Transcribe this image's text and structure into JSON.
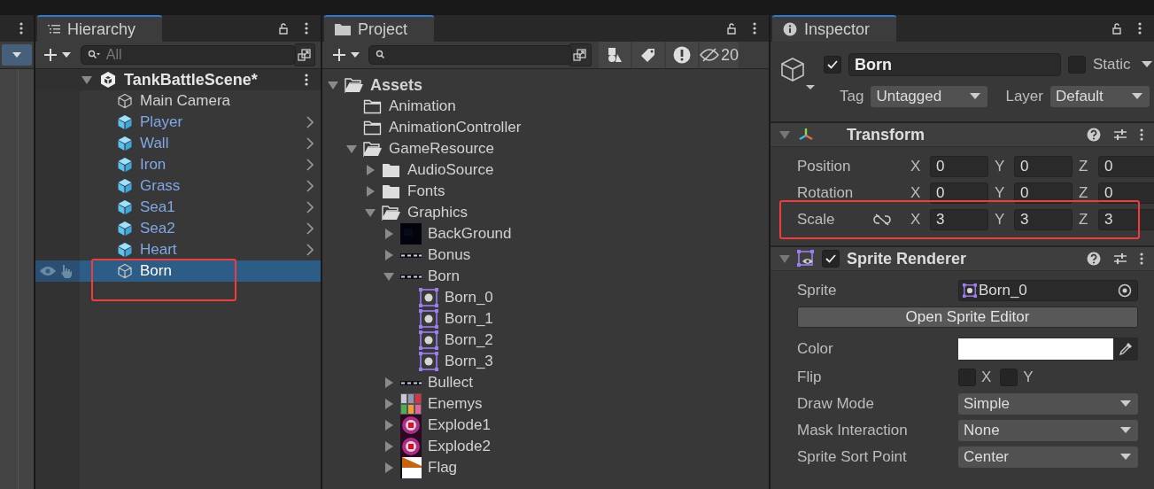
{
  "hierarchy": {
    "tab": "Hierarchy",
    "search": {
      "placeholder": "All"
    },
    "scene": {
      "name": "TankBattleScene*",
      "expanded": true
    },
    "items": [
      {
        "name": "Main Camera",
        "kind": "object",
        "selected": false,
        "annotated": false
      },
      {
        "name": "Player",
        "kind": "prefab",
        "selected": false,
        "annotated": false
      },
      {
        "name": "Wall",
        "kind": "prefab",
        "selected": false,
        "annotated": false
      },
      {
        "name": "Iron",
        "kind": "prefab",
        "selected": false,
        "annotated": false
      },
      {
        "name": "Grass",
        "kind": "prefab",
        "selected": false,
        "annotated": false
      },
      {
        "name": "Sea1",
        "kind": "prefab",
        "selected": false,
        "annotated": false
      },
      {
        "name": "Sea2",
        "kind": "prefab",
        "selected": false,
        "annotated": false
      },
      {
        "name": "Heart",
        "kind": "prefab",
        "selected": false,
        "annotated": false
      },
      {
        "name": "Born",
        "kind": "object",
        "selected": true,
        "annotated": true
      }
    ]
  },
  "project": {
    "tab": "Project",
    "hidden_count": "20",
    "tree": [
      {
        "name": "Assets",
        "kind": "folder",
        "expanded": true,
        "children": [
          {
            "name": "Animation",
            "kind": "folder"
          },
          {
            "name": "AnimationController",
            "kind": "folder"
          },
          {
            "name": "GameResource",
            "kind": "folder",
            "expanded": true,
            "children": [
              {
                "name": "AudioSource",
                "kind": "folder",
                "expanded": false
              },
              {
                "name": "Fonts",
                "kind": "folder",
                "expanded": false
              },
              {
                "name": "Graphics",
                "kind": "folder",
                "expanded": true,
                "children": [
                  {
                    "name": "BackGround",
                    "kind": "texture-dark",
                    "expanded": false
                  },
                  {
                    "name": "Bonus",
                    "kind": "texture-strip",
                    "expanded": false
                  },
                  {
                    "name": "Born",
                    "kind": "texture-strip",
                    "expanded": true,
                    "children": [
                      {
                        "name": "Born_0",
                        "kind": "sprite"
                      },
                      {
                        "name": "Born_1",
                        "kind": "sprite"
                      },
                      {
                        "name": "Born_2",
                        "kind": "sprite"
                      },
                      {
                        "name": "Born_3",
                        "kind": "sprite"
                      }
                    ]
                  },
                  {
                    "name": "Bullect",
                    "kind": "texture-strip",
                    "expanded": false
                  },
                  {
                    "name": "Enemys",
                    "kind": "texture-grid",
                    "expanded": false
                  },
                  {
                    "name": "Explode1",
                    "kind": "texture-burst",
                    "expanded": false
                  },
                  {
                    "name": "Explode2",
                    "kind": "texture-burst",
                    "expanded": false
                  },
                  {
                    "name": "Flag",
                    "kind": "texture-flag",
                    "expanded": false
                  }
                ]
              }
            ]
          }
        ]
      }
    ]
  },
  "inspector": {
    "tab": "Inspector",
    "object": {
      "active": true,
      "name": "Born",
      "static": false,
      "static_label": "Static",
      "tag_label": "Tag",
      "tag": "Untagged",
      "layer_label": "Layer",
      "layer": "Default"
    },
    "components": [
      {
        "kind": "transform",
        "title": "Transform",
        "expanded": true,
        "rows": [
          {
            "label": "Position",
            "axes": [
              {
                "axis": "X",
                "value": "0"
              },
              {
                "axis": "Y",
                "value": "0"
              },
              {
                "axis": "Z",
                "value": "0"
              }
            ]
          },
          {
            "label": "Rotation",
            "axes": [
              {
                "axis": "X",
                "value": "0"
              },
              {
                "axis": "Y",
                "value": "0"
              },
              {
                "axis": "Z",
                "value": "0"
              }
            ]
          },
          {
            "label": "Scale",
            "annotated": true,
            "constrain_proportions": false,
            "axes": [
              {
                "axis": "X",
                "value": "3"
              },
              {
                "axis": "Y",
                "value": "3"
              },
              {
                "axis": "Z",
                "value": "3"
              }
            ]
          }
        ]
      },
      {
        "kind": "sprite-renderer",
        "title": "Sprite Renderer",
        "expanded": true,
        "enabled": true,
        "fields": [
          {
            "kind": "sprite-field",
            "label": "Sprite",
            "value": "Born_0"
          },
          {
            "kind": "button",
            "label": "Open Sprite Editor"
          },
          {
            "kind": "color",
            "label": "Color",
            "color": "#ffffff"
          },
          {
            "kind": "flip",
            "label": "Flip",
            "x_label": "X",
            "x": false,
            "y_label": "Y",
            "y": false
          },
          {
            "kind": "dropdown",
            "label": "Draw Mode",
            "value": "Simple"
          },
          {
            "kind": "dropdown",
            "label": "Mask Interaction",
            "value": "None"
          },
          {
            "kind": "dropdown",
            "label": "Sprite Sort Point",
            "value": "Center"
          }
        ]
      }
    ]
  }
}
